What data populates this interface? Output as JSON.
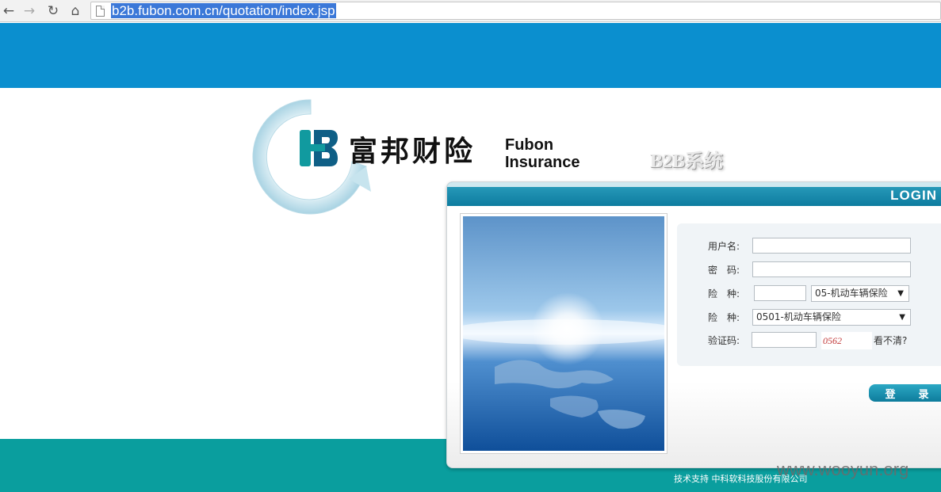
{
  "browser": {
    "url": "b2b.fubon.com.cn/quotation/index.jsp"
  },
  "brand": {
    "name_cn": "富邦财险",
    "name_en_line1": "Fubon",
    "name_en_line2": "Insurance",
    "system_label": "B2B系统"
  },
  "login": {
    "title": "LOGIN",
    "username_label": "用户名:",
    "password_label": "密　码:",
    "insurance_label": "险　种:",
    "insurance_type_label": "险　种:",
    "insurance_select_value": "05-机动车辆保险",
    "insurance_type_select_value": "0501-机动车辆保险",
    "captcha_label": "验证码:",
    "captcha_code": "0562",
    "captcha_refresh": "看不清?",
    "submit": "登　录"
  },
  "footer": {
    "support_text": "技术支持 中科软科技股份有限公司",
    "watermark": "www.wooyun.org"
  },
  "colors": {
    "header_blue": "#0b8fcf",
    "footer_teal": "#0a9e9e",
    "login_header": "#0d7c9f"
  }
}
